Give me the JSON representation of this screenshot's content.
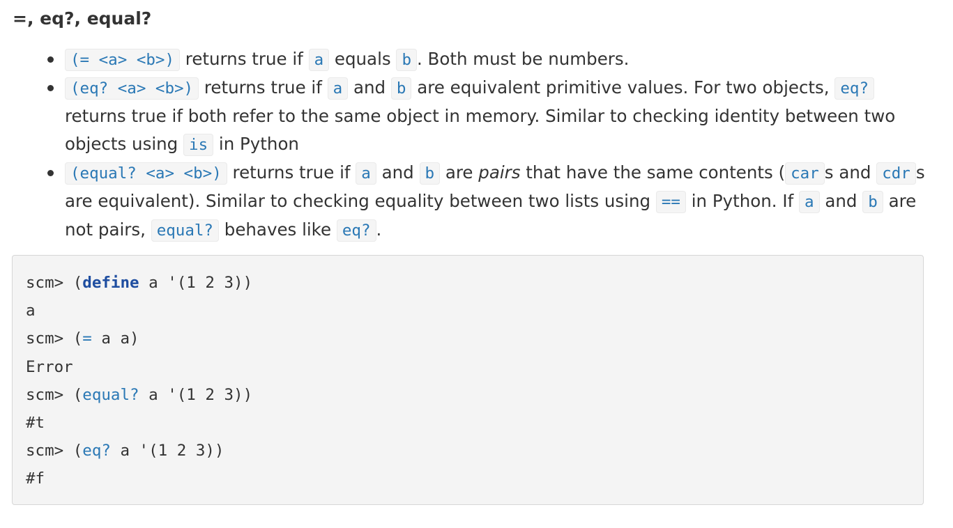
{
  "section": {
    "title": "=, eq?, equal?"
  },
  "bullets": [
    {
      "code_expr": "(= <a> <b>)",
      "t1": " returns true if ",
      "code_a": "a",
      "t2": " equals ",
      "code_b": "b",
      "t3": ". Both must be numbers."
    },
    {
      "code_expr": "(eq? <a> <b>)",
      "t1": " returns true if ",
      "code_a": "a",
      "t2": " and ",
      "code_b": "b",
      "t3": " are equivalent primitive values. For two objects, ",
      "code_eq": "eq?",
      "t4": " returns true if both refer to the same object in memory. Similar to checking identity between two objects using ",
      "code_is": "is",
      "t5": " in Python"
    },
    {
      "code_expr": "(equal? <a> <b>)",
      "t1": " returns true if ",
      "code_a": "a",
      "t2": " and ",
      "code_b": "b",
      "t3": " are ",
      "em_pairs": "pairs",
      "t4": " that have the same contents (",
      "code_car": "car",
      "t5": "s and ",
      "code_cdr": "cdr",
      "t6": "s are equivalent). Similar to checking equality between two lists using ",
      "code_eqeq": "==",
      "t7": " in Python. If ",
      "code_a2": "a",
      "t8": " and ",
      "code_b2": "b",
      "t9": " are not pairs, ",
      "code_equal": "equal?",
      "t10": " behaves like ",
      "code_eq": "eq?",
      "t11": "."
    }
  ],
  "code_block": {
    "lines": [
      {
        "prompt": "scm> ",
        "open": "(",
        "keyword": "define",
        "rest": " a '(1 2 3))"
      },
      {
        "output": "a"
      },
      {
        "prompt": "scm> ",
        "open": "(",
        "func": "=",
        "rest": " a a)"
      },
      {
        "output": "Error"
      },
      {
        "prompt": "scm> ",
        "open": "(",
        "func": "equal?",
        "rest": " a '(1 2 3))"
      },
      {
        "output": "#t"
      },
      {
        "prompt": "scm> ",
        "open": "(",
        "func": "eq?",
        "rest": " a '(1 2 3))"
      },
      {
        "output": "#f"
      }
    ]
  },
  "colors": {
    "text": "#333333",
    "inline_code": "#2a78b5",
    "inline_code_bg": "#f5f5f5",
    "keyword": "#1f4ea0",
    "code_block_bg": "#f4f4f4",
    "code_block_border": "#d6d6d6"
  }
}
